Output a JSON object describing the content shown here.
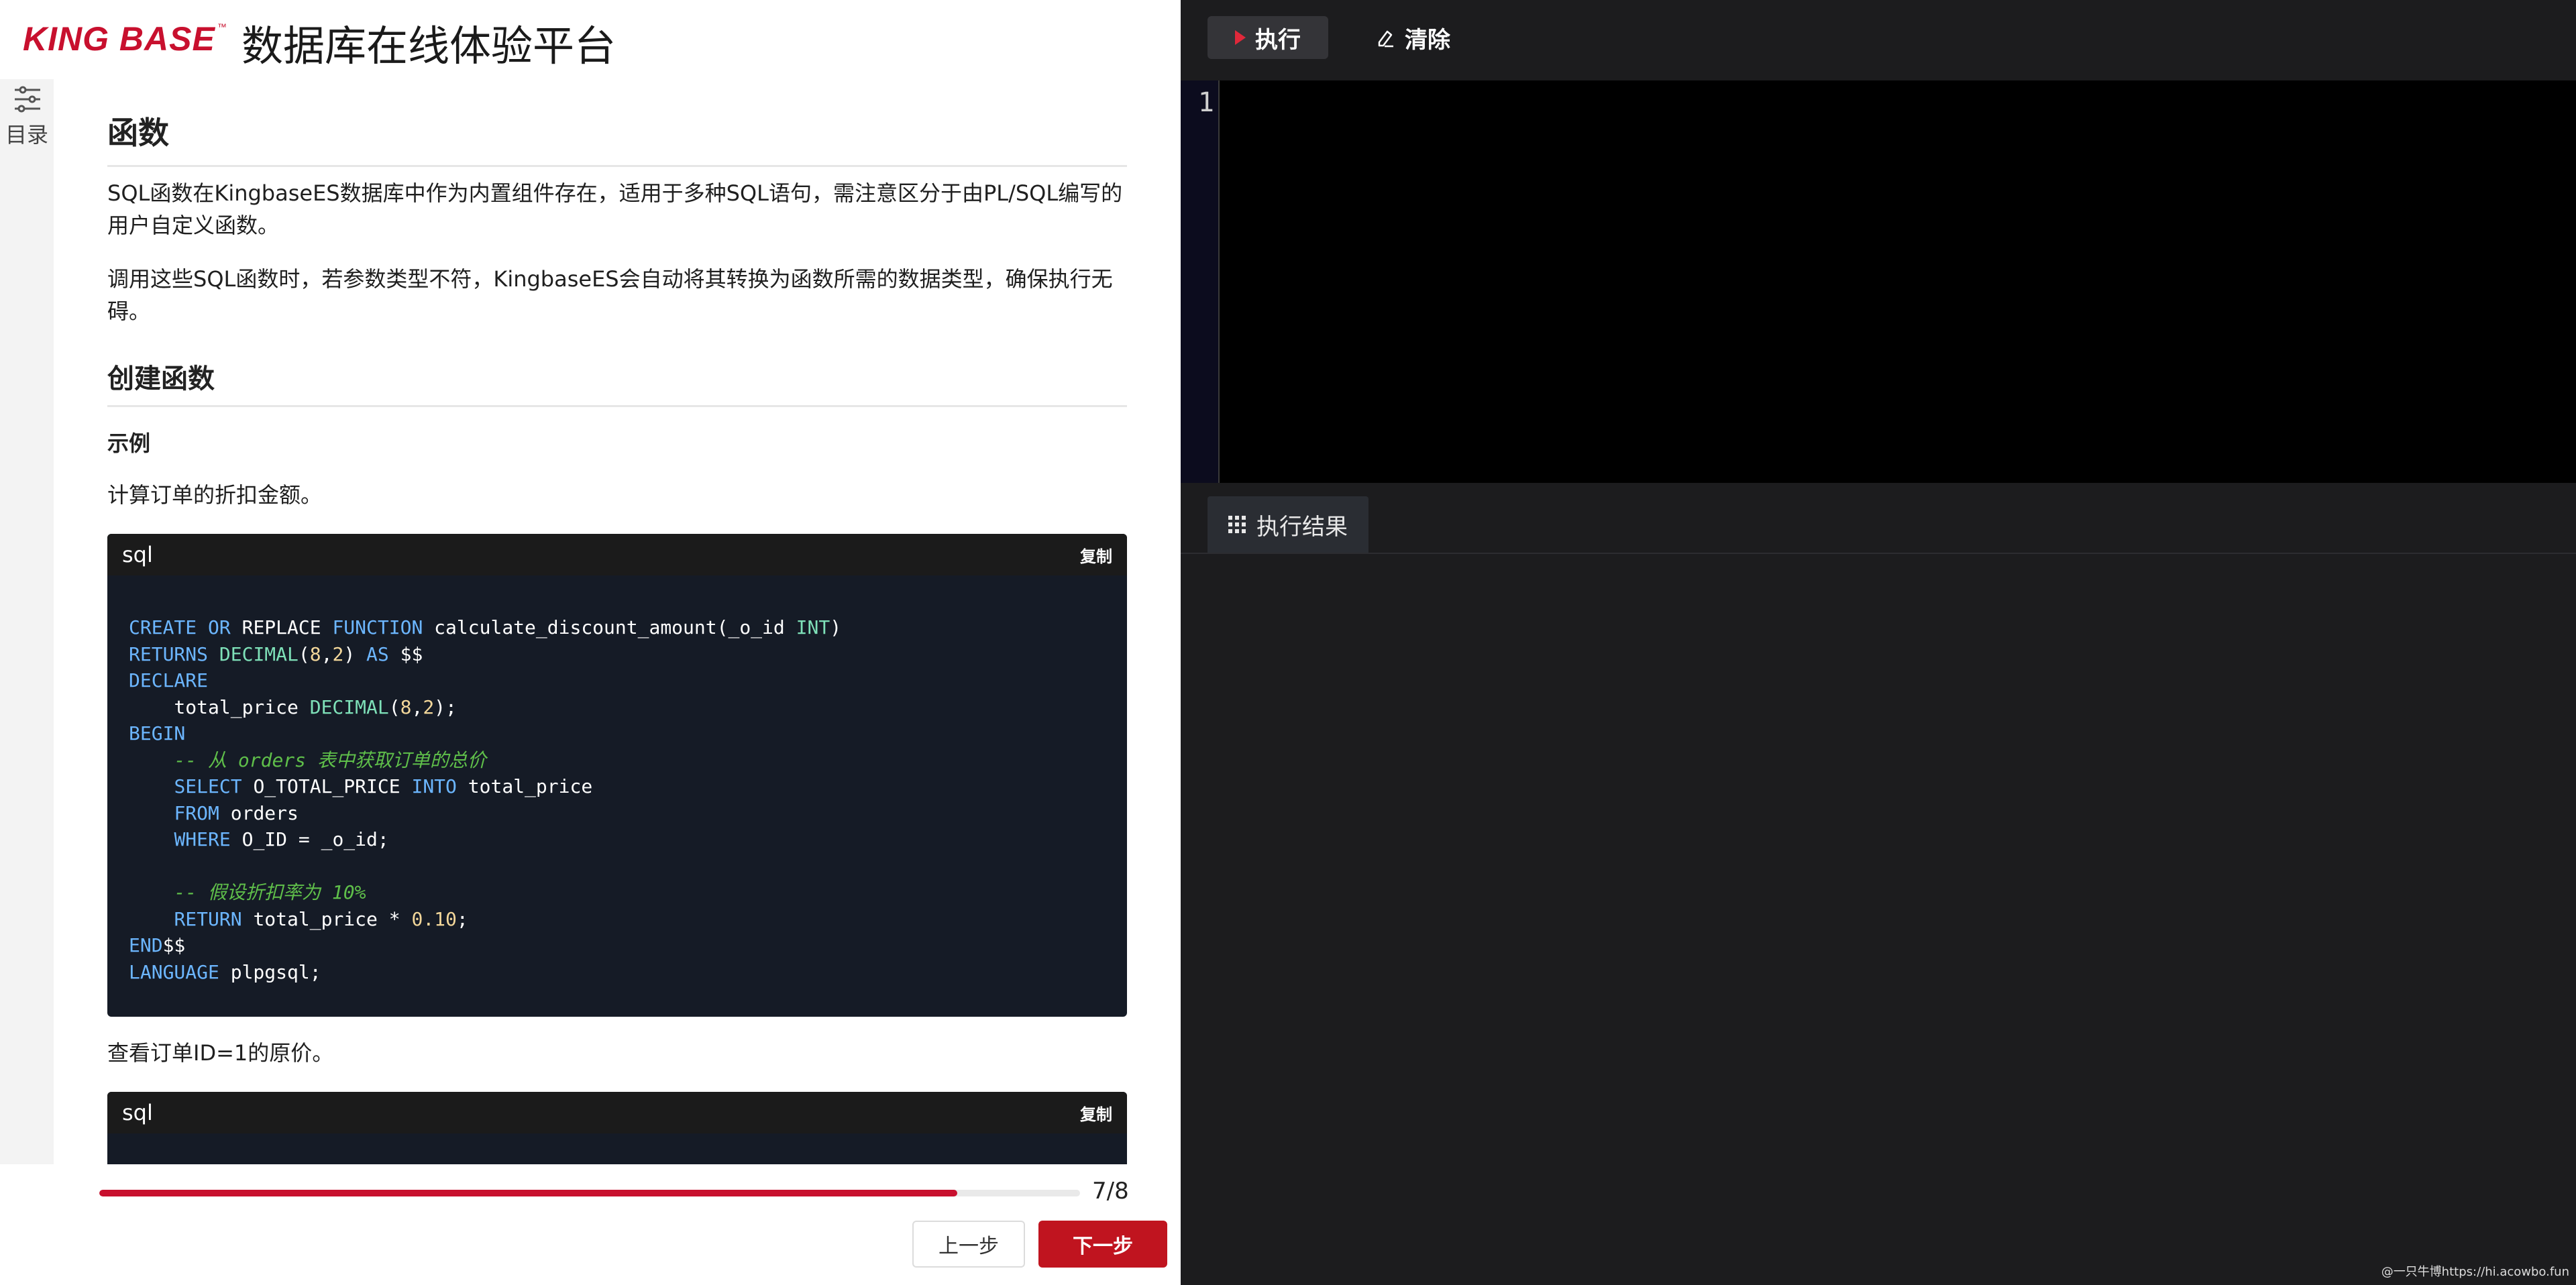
{
  "header": {
    "logo_text": "KING BASE",
    "logo_tm": "™",
    "title": "数据库在线体验平台",
    "brand_color": "#c8102e"
  },
  "toc": {
    "label": "目录",
    "icon": "sliders-icon"
  },
  "article": {
    "h1": "函数",
    "p1": "SQL函数在KingbaseES数据库中作为内置组件存在，适用于多种SQL语句，需注意区分于由PL/SQL编写的用户自定义函数。",
    "p2": "调用这些SQL函数时，若参数类型不符，KingbaseES会自动将其转换为函数所需的数据类型，确保执行无碍。",
    "h2": "创建函数",
    "h3": "示例",
    "p3": "计算订单的折扣金额。",
    "code1": {
      "lang": "sql",
      "copy": "复制",
      "lines": [
        "CREATE OR REPLACE FUNCTION calculate_discount_amount(_o_id INT)",
        "RETURNS DECIMAL(8,2) AS $$",
        "DECLARE",
        "    total_price DECIMAL(8,2);",
        "BEGIN",
        "    -- 从 orders 表中获取订单的总价",
        "    SELECT O_TOTAL_PRICE INTO total_price",
        "    FROM orders",
        "    WHERE O_ID = _o_id;",
        "",
        "    -- 假设折扣率为 10%",
        "    RETURN total_price * 0.10;",
        "END$$",
        "LANGUAGE plpgsql;"
      ]
    },
    "p4": "查看订单ID=1的原价。",
    "code2": {
      "lang": "sql",
      "copy": "复制"
    }
  },
  "footer": {
    "progress_current": 7,
    "progress_total": 8,
    "progress_fraction": 0.875,
    "progress_text": "7/8",
    "prev_label": "上一步",
    "next_label": "下一步"
  },
  "editor_toolbar": {
    "run_label": "执行",
    "clear_label": "清除",
    "run_icon": "play-icon",
    "clear_icon": "eraser-icon"
  },
  "editor": {
    "line_numbers": [
      "1"
    ]
  },
  "results": {
    "tab_label": "执行结果",
    "tab_icon": "grid-icon"
  },
  "watermark": "@一只牛博https://hi.acowbo.fun"
}
